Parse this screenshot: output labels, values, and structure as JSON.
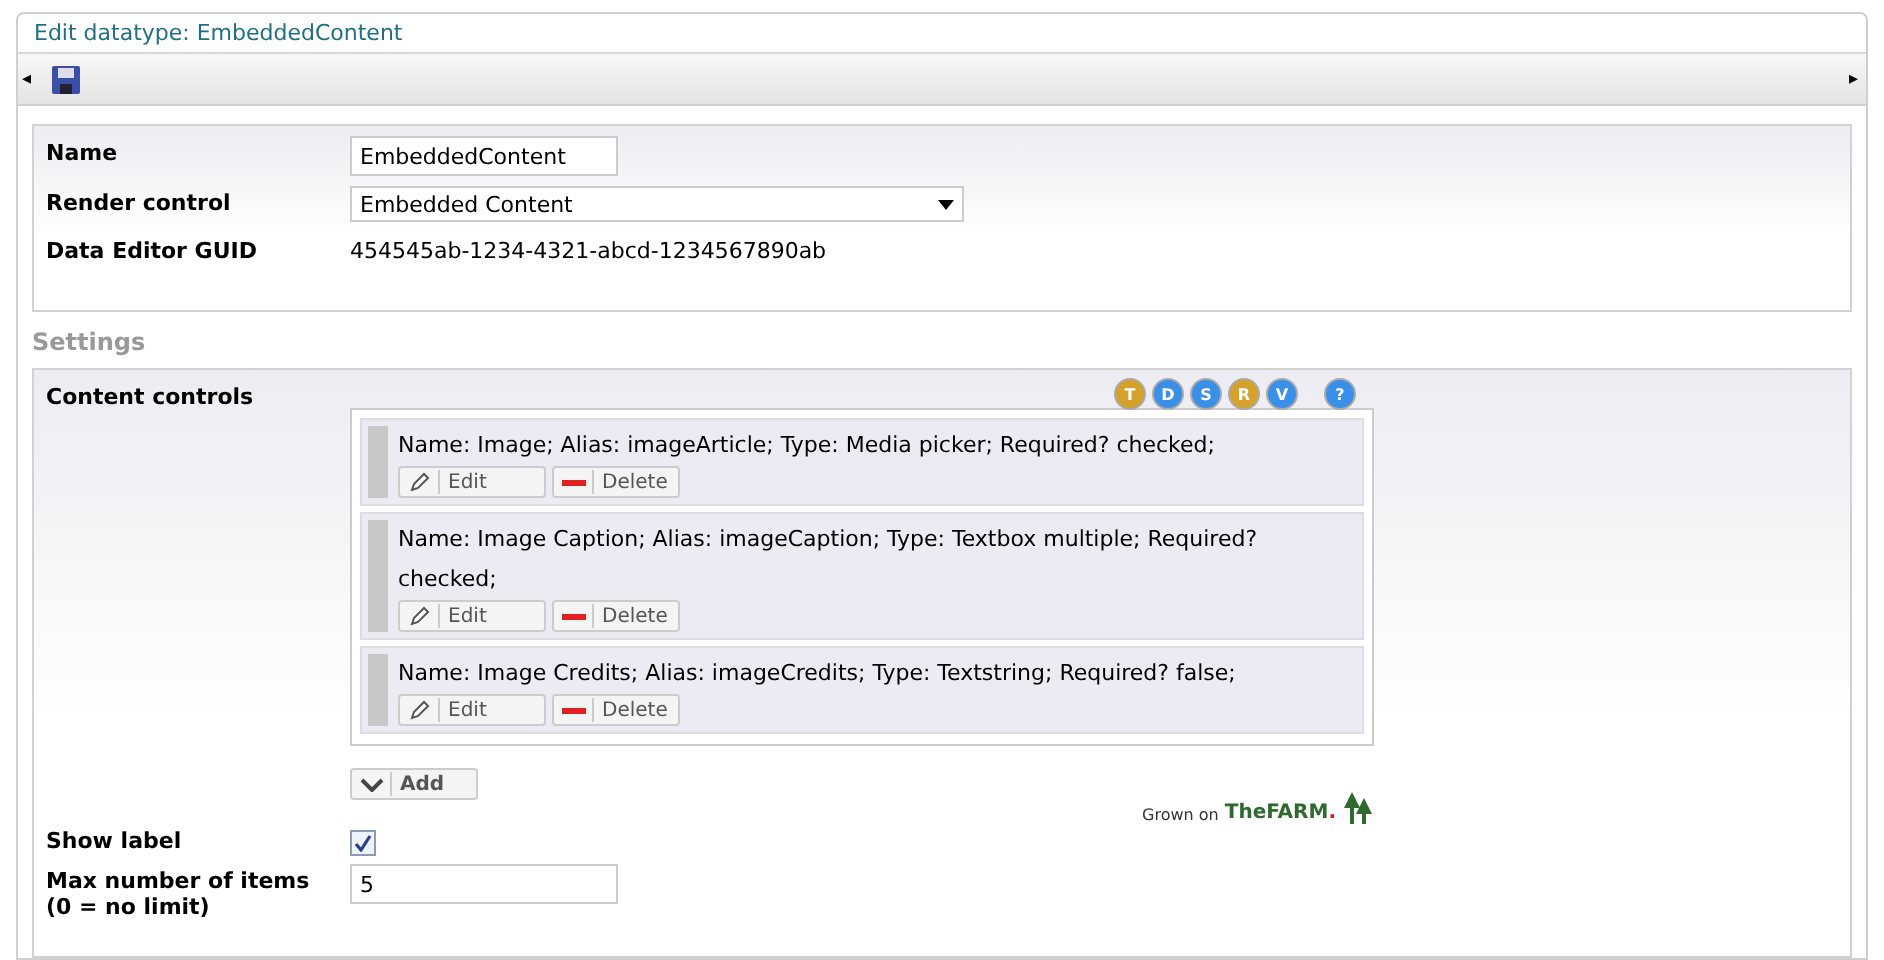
{
  "window": {
    "title": "Edit datatype: EmbeddedContent"
  },
  "toolbar": {
    "left_arrow": "◂",
    "right_arrow": "▸"
  },
  "properties": [
    {
      "kind": "text",
      "label": "Name",
      "value": "EmbeddedContent"
    },
    {
      "kind": "select",
      "label": "Render control",
      "value": "Embedded Content"
    },
    {
      "kind": "plain",
      "label": "Data Editor GUID",
      "value": "454545ab-1234-4321-abcd-1234567890ab"
    }
  ],
  "settings": {
    "title": "Settings",
    "content_controls": {
      "label": "Content controls",
      "help_icons": [
        {
          "letter": "T",
          "color": "#d4a12a"
        },
        {
          "letter": "D",
          "color": "#3a8fe8"
        },
        {
          "letter": "S",
          "color": "#3a8fe8"
        },
        {
          "letter": "R",
          "color": "#d4a12a"
        },
        {
          "letter": "V",
          "color": "#3a8fe8"
        },
        {
          "letter": "?",
          "color": "#3a8fe8"
        }
      ],
      "items": [
        {
          "text": "Name: Image; Alias: imageArticle; Type: Media picker; Required? checked;",
          "edit": "Edit",
          "delete": "Delete"
        },
        {
          "text": "Name: Image Caption; Alias: imageCaption; Type: Textbox multiple; Required? checked;",
          "edit": "Edit",
          "delete": "Delete"
        },
        {
          "text": "Name: Image Credits; Alias: imageCredits; Type: Textstring; Required? false;",
          "edit": "Edit",
          "delete": "Delete"
        }
      ],
      "add": "Add",
      "logo": {
        "prefix": "Grown on",
        "brand_a": "The",
        "brand_b": "FARM",
        "dot": "."
      }
    },
    "show_label": {
      "label": "Show label",
      "checked": true
    },
    "max_items": {
      "label": "Max number of items (0 = no limit)",
      "value": "5"
    }
  }
}
